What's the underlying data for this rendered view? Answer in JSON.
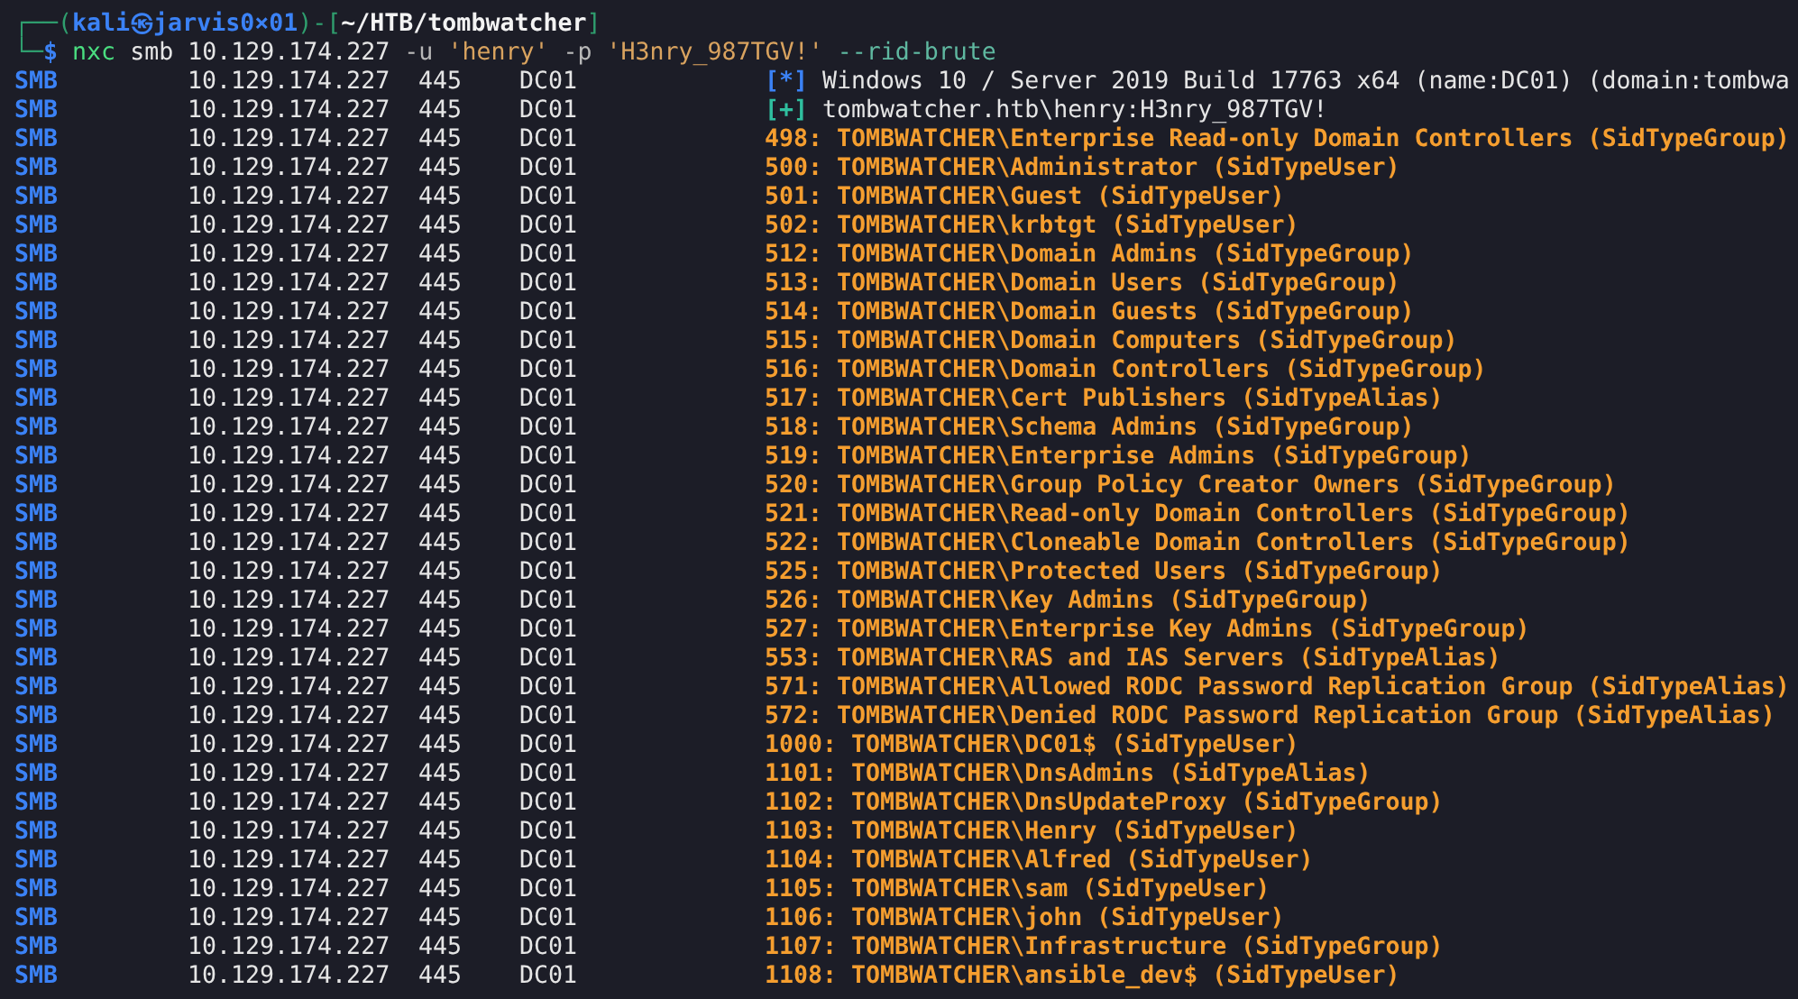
{
  "prompt": {
    "line1": [
      {
        "text": "┌──(",
        "kind": "frame"
      },
      {
        "text": "kali㉿jarvis0×01",
        "kind": "user"
      },
      {
        "text": ")-[",
        "kind": "frame"
      },
      {
        "text": "~/HTB/tombwatcher",
        "kind": "path"
      },
      {
        "text": "]",
        "kind": "frame"
      }
    ],
    "line2": [
      {
        "text": "└─",
        "kind": "frame"
      },
      {
        "text": "$",
        "kind": "symbol"
      }
    ],
    "command": [
      {
        "text": "nxc",
        "kind": "program"
      },
      {
        "text": "smb",
        "kind": "arg"
      },
      {
        "text": "10.129.174.227",
        "kind": "arg"
      },
      {
        "text": "-u",
        "kind": "flag"
      },
      {
        "text": "'henry'",
        "kind": "string"
      },
      {
        "text": "-p",
        "kind": "flag"
      },
      {
        "text": "'H3nry_987TGV!'",
        "kind": "string"
      },
      {
        "text": "--rid-brute",
        "kind": "option"
      }
    ]
  },
  "rows": [
    {
      "protocol": "SMB",
      "host": "10.129.174.227",
      "port": "445",
      "name": "DC01",
      "kind": "info",
      "marker": "[*]",
      "color": "#3b82f6",
      "message": "Windows 10 / Server 2019 Build 17763 x64 (name:DC01) (domain:tombwa"
    },
    {
      "protocol": "SMB",
      "host": "10.129.174.227",
      "port": "445",
      "name": "DC01",
      "kind": "info",
      "marker": "[+]",
      "color": "#2fbf9f",
      "message": "tombwatcher.htb\\henry:H3nry_987TGV!"
    },
    {
      "protocol": "SMB",
      "host": "10.129.174.227",
      "port": "445",
      "name": "DC01",
      "kind": "result",
      "message": "498: TOMBWATCHER\\Enterprise Read-only Domain Controllers (SidTypeGroup)"
    },
    {
      "protocol": "SMB",
      "host": "10.129.174.227",
      "port": "445",
      "name": "DC01",
      "kind": "result",
      "message": "500: TOMBWATCHER\\Administrator (SidTypeUser)"
    },
    {
      "protocol": "SMB",
      "host": "10.129.174.227",
      "port": "445",
      "name": "DC01",
      "kind": "result",
      "message": "501: TOMBWATCHER\\Guest (SidTypeUser)"
    },
    {
      "protocol": "SMB",
      "host": "10.129.174.227",
      "port": "445",
      "name": "DC01",
      "kind": "result",
      "message": "502: TOMBWATCHER\\krbtgt (SidTypeUser)"
    },
    {
      "protocol": "SMB",
      "host": "10.129.174.227",
      "port": "445",
      "name": "DC01",
      "kind": "result",
      "message": "512: TOMBWATCHER\\Domain Admins (SidTypeGroup)"
    },
    {
      "protocol": "SMB",
      "host": "10.129.174.227",
      "port": "445",
      "name": "DC01",
      "kind": "result",
      "message": "513: TOMBWATCHER\\Domain Users (SidTypeGroup)"
    },
    {
      "protocol": "SMB",
      "host": "10.129.174.227",
      "port": "445",
      "name": "DC01",
      "kind": "result",
      "message": "514: TOMBWATCHER\\Domain Guests (SidTypeGroup)"
    },
    {
      "protocol": "SMB",
      "host": "10.129.174.227",
      "port": "445",
      "name": "DC01",
      "kind": "result",
      "message": "515: TOMBWATCHER\\Domain Computers (SidTypeGroup)"
    },
    {
      "protocol": "SMB",
      "host": "10.129.174.227",
      "port": "445",
      "name": "DC01",
      "kind": "result",
      "message": "516: TOMBWATCHER\\Domain Controllers (SidTypeGroup)"
    },
    {
      "protocol": "SMB",
      "host": "10.129.174.227",
      "port": "445",
      "name": "DC01",
      "kind": "result",
      "message": "517: TOMBWATCHER\\Cert Publishers (SidTypeAlias)"
    },
    {
      "protocol": "SMB",
      "host": "10.129.174.227",
      "port": "445",
      "name": "DC01",
      "kind": "result",
      "message": "518: TOMBWATCHER\\Schema Admins (SidTypeGroup)"
    },
    {
      "protocol": "SMB",
      "host": "10.129.174.227",
      "port": "445",
      "name": "DC01",
      "kind": "result",
      "message": "519: TOMBWATCHER\\Enterprise Admins (SidTypeGroup)"
    },
    {
      "protocol": "SMB",
      "host": "10.129.174.227",
      "port": "445",
      "name": "DC01",
      "kind": "result",
      "message": "520: TOMBWATCHER\\Group Policy Creator Owners (SidTypeGroup)"
    },
    {
      "protocol": "SMB",
      "host": "10.129.174.227",
      "port": "445",
      "name": "DC01",
      "kind": "result",
      "message": "521: TOMBWATCHER\\Read-only Domain Controllers (SidTypeGroup)"
    },
    {
      "protocol": "SMB",
      "host": "10.129.174.227",
      "port": "445",
      "name": "DC01",
      "kind": "result",
      "message": "522: TOMBWATCHER\\Cloneable Domain Controllers (SidTypeGroup)"
    },
    {
      "protocol": "SMB",
      "host": "10.129.174.227",
      "port": "445",
      "name": "DC01",
      "kind": "result",
      "message": "525: TOMBWATCHER\\Protected Users (SidTypeGroup)"
    },
    {
      "protocol": "SMB",
      "host": "10.129.174.227",
      "port": "445",
      "name": "DC01",
      "kind": "result",
      "message": "526: TOMBWATCHER\\Key Admins (SidTypeGroup)"
    },
    {
      "protocol": "SMB",
      "host": "10.129.174.227",
      "port": "445",
      "name": "DC01",
      "kind": "result",
      "message": "527: TOMBWATCHER\\Enterprise Key Admins (SidTypeGroup)"
    },
    {
      "protocol": "SMB",
      "host": "10.129.174.227",
      "port": "445",
      "name": "DC01",
      "kind": "result",
      "message": "553: TOMBWATCHER\\RAS and IAS Servers (SidTypeAlias)"
    },
    {
      "protocol": "SMB",
      "host": "10.129.174.227",
      "port": "445",
      "name": "DC01",
      "kind": "result",
      "message": "571: TOMBWATCHER\\Allowed RODC Password Replication Group (SidTypeAlias)"
    },
    {
      "protocol": "SMB",
      "host": "10.129.174.227",
      "port": "445",
      "name": "DC01",
      "kind": "result",
      "message": "572: TOMBWATCHER\\Denied RODC Password Replication Group (SidTypeAlias)"
    },
    {
      "protocol": "SMB",
      "host": "10.129.174.227",
      "port": "445",
      "name": "DC01",
      "kind": "result",
      "message": "1000: TOMBWATCHER\\DC01$ (SidTypeUser)"
    },
    {
      "protocol": "SMB",
      "host": "10.129.174.227",
      "port": "445",
      "name": "DC01",
      "kind": "result",
      "message": "1101: TOMBWATCHER\\DnsAdmins (SidTypeAlias)"
    },
    {
      "protocol": "SMB",
      "host": "10.129.174.227",
      "port": "445",
      "name": "DC01",
      "kind": "result",
      "message": "1102: TOMBWATCHER\\DnsUpdateProxy (SidTypeGroup)"
    },
    {
      "protocol": "SMB",
      "host": "10.129.174.227",
      "port": "445",
      "name": "DC01",
      "kind": "result",
      "message": "1103: TOMBWATCHER\\Henry (SidTypeUser)"
    },
    {
      "protocol": "SMB",
      "host": "10.129.174.227",
      "port": "445",
      "name": "DC01",
      "kind": "result",
      "message": "1104: TOMBWATCHER\\Alfred (SidTypeUser)"
    },
    {
      "protocol": "SMB",
      "host": "10.129.174.227",
      "port": "445",
      "name": "DC01",
      "kind": "result",
      "message": "1105: TOMBWATCHER\\sam (SidTypeUser)"
    },
    {
      "protocol": "SMB",
      "host": "10.129.174.227",
      "port": "445",
      "name": "DC01",
      "kind": "result",
      "message": "1106: TOMBWATCHER\\john (SidTypeUser)"
    },
    {
      "protocol": "SMB",
      "host": "10.129.174.227",
      "port": "445",
      "name": "DC01",
      "kind": "result",
      "message": "1107: TOMBWATCHER\\Infrastructure (SidTypeGroup)"
    },
    {
      "protocol": "SMB",
      "host": "10.129.174.227",
      "port": "445",
      "name": "DC01",
      "kind": "result",
      "message": "1108: TOMBWATCHER\\ansible_dev$ (SidTypeUser)"
    }
  ]
}
